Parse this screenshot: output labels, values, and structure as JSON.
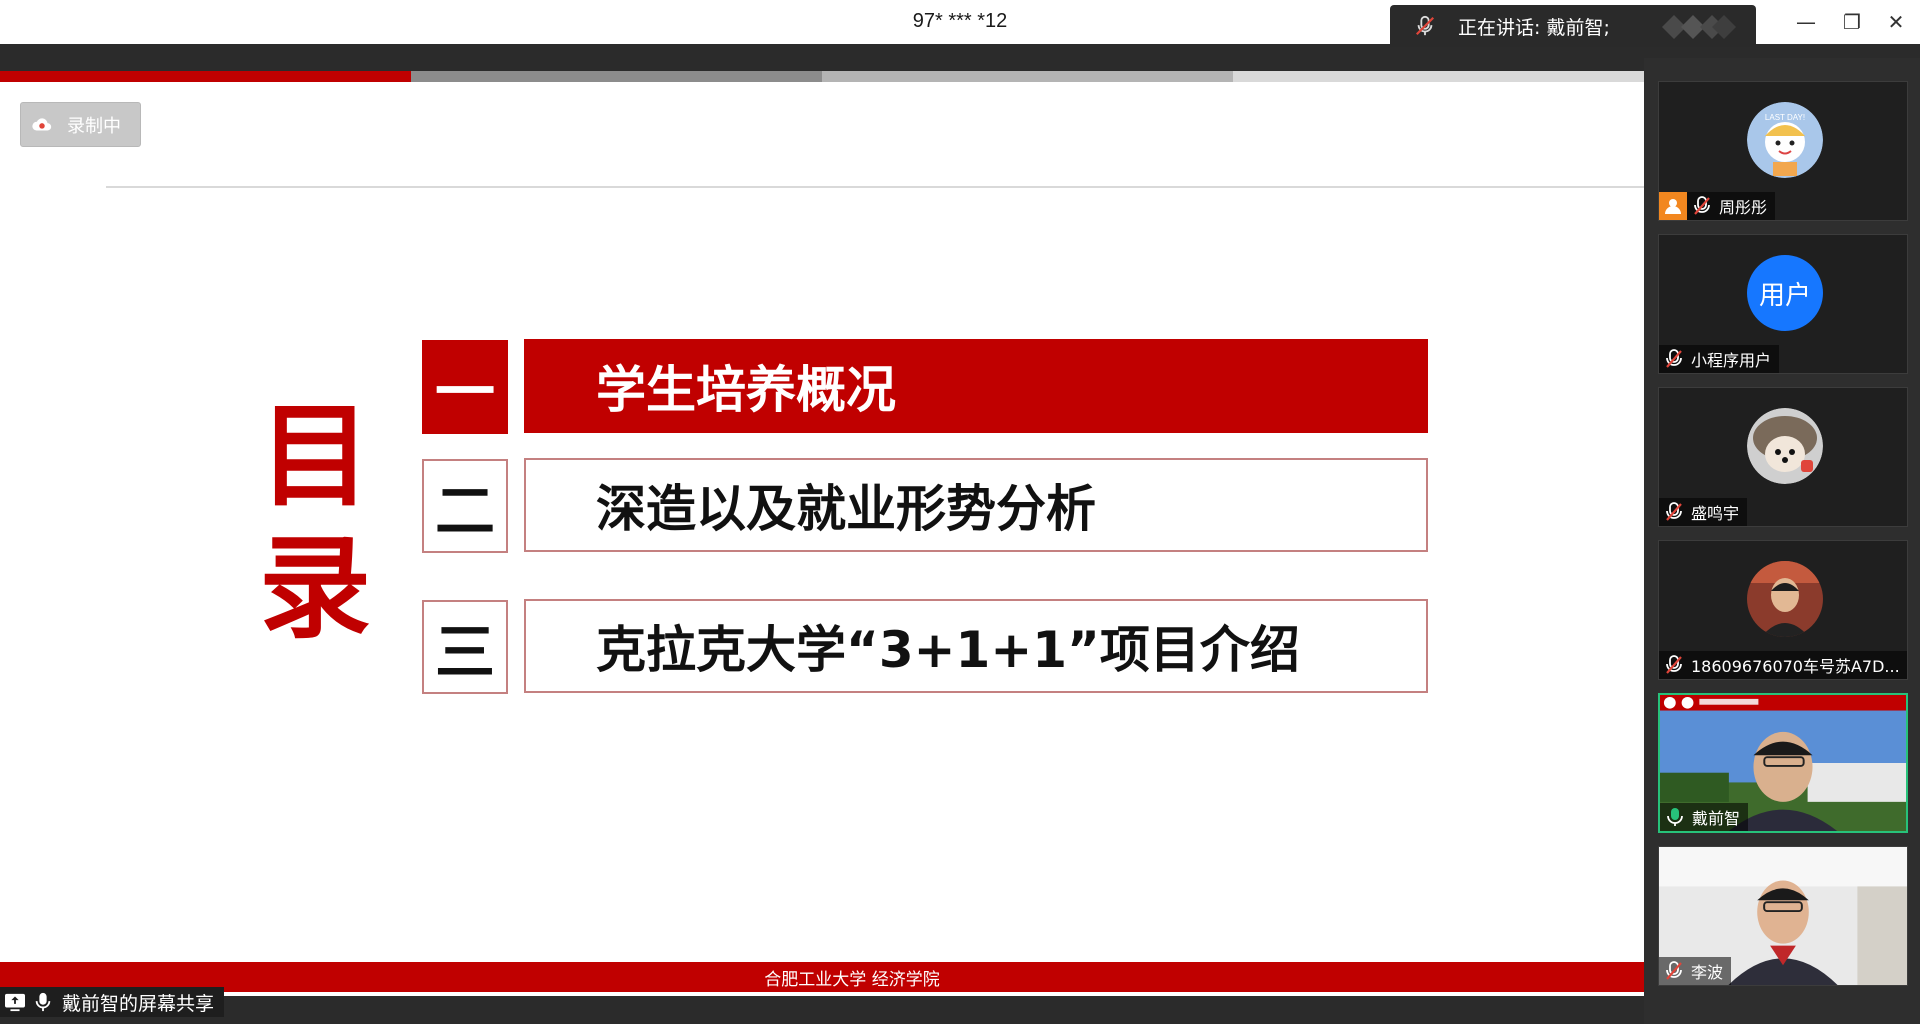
{
  "window": {
    "meeting_id": "97* *** *12",
    "minimize_glyph": "—",
    "restore_glyph": "❐",
    "close_glyph": "✕"
  },
  "speaker_banner": {
    "text": "正在讲话: 戴前智;",
    "mic_icon": "mic-muted-icon"
  },
  "recording": {
    "label": "录制中",
    "icon": "cloud-record-icon"
  },
  "slide": {
    "progress_colors": [
      "#c00000",
      "#8c8c8c",
      "#b4b4b4",
      "#d9d9d9"
    ],
    "toc_title": [
      "目",
      "录"
    ],
    "items": [
      {
        "num": "一",
        "text": "学生培养概况",
        "active": true
      },
      {
        "num": "二",
        "text": "深造以及就业形势分析",
        "active": false
      },
      {
        "num": "三",
        "text": "克拉克大学“3+1+1”项目介绍",
        "active": false
      }
    ],
    "footer": "合肥工业大学 经济学院",
    "accent_color": "#c00000"
  },
  "share": {
    "label": "戴前智的屏幕共享",
    "icon": "screen-share-icon"
  },
  "participants": [
    {
      "name": "周彤彤",
      "type": "avatar-cartoon",
      "host": true,
      "mic": "muted"
    },
    {
      "name": "小程序用户",
      "type": "avatar-text",
      "avatar_text": "用户",
      "host": false,
      "mic": "muted"
    },
    {
      "name": "盛鸣宇",
      "type": "avatar-hedgehog",
      "host": false,
      "mic": "muted"
    },
    {
      "name": "18609676070车号苏A7D...",
      "type": "avatar-photo",
      "host": false,
      "mic": "muted"
    },
    {
      "name": "戴前智",
      "type": "video-campus",
      "host": false,
      "mic": "active",
      "speaking": true
    },
    {
      "name": "李波",
      "type": "video-room",
      "host": false,
      "mic": "muted"
    }
  ]
}
